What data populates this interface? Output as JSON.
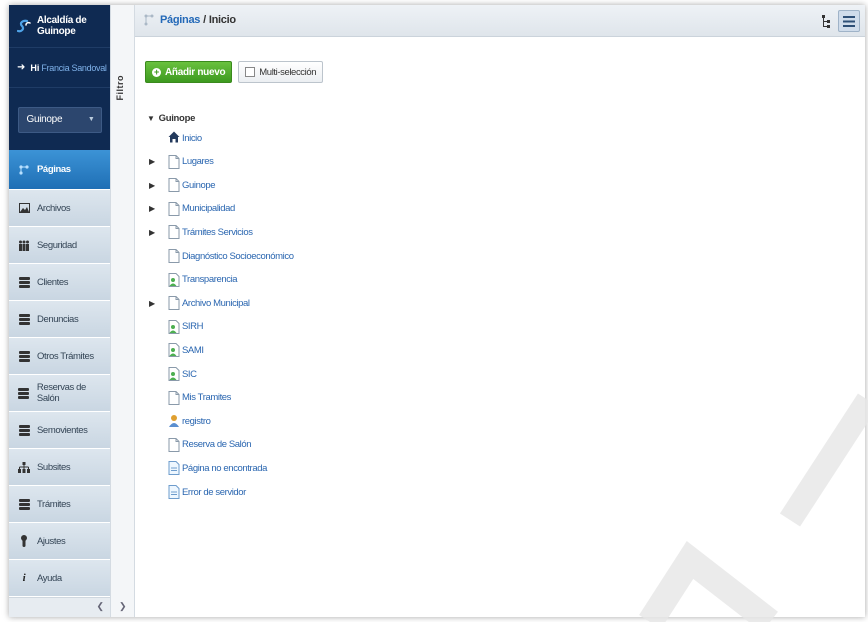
{
  "brand": {
    "line1": "Alcaldía de",
    "line2": "Guinope"
  },
  "user": {
    "greeting": "Hi",
    "name": "Francia Sandoval"
  },
  "site_select": {
    "value": "Guinope"
  },
  "sidebar": {
    "items": [
      {
        "label": "Páginas",
        "icon": "pages-icon",
        "active": true
      },
      {
        "label": "Archivos",
        "icon": "image-icon"
      },
      {
        "label": "Seguridad",
        "icon": "users-icon"
      },
      {
        "label": "Clientes",
        "icon": "database-icon"
      },
      {
        "label": "Denuncias",
        "icon": "database-icon"
      },
      {
        "label": "Otros Trámites",
        "icon": "database-icon"
      },
      {
        "label": "Reservas de Salón",
        "icon": "database-icon"
      },
      {
        "label": "Semovientes",
        "icon": "database-icon"
      },
      {
        "label": "Subsites",
        "icon": "sitemap-icon"
      },
      {
        "label": "Trámites",
        "icon": "database-icon"
      },
      {
        "label": "Ajustes",
        "icon": "wrench-icon"
      },
      {
        "label": "Ayuda",
        "icon": "info-icon"
      }
    ]
  },
  "filter_panel": {
    "label": "Filtro"
  },
  "breadcrumb": {
    "section": "Páginas",
    "separator": "/",
    "current": "Inicio"
  },
  "toolbar": {
    "add_label": "Añadir nuevo",
    "multi_label": "Multi-selección"
  },
  "tree": {
    "root": "Guinope",
    "nodes": [
      {
        "label": "Inicio",
        "icon": "home-icon",
        "expandable": false
      },
      {
        "label": "Lugares",
        "icon": "page-icon",
        "expandable": true
      },
      {
        "label": "Guinope",
        "icon": "page-icon",
        "expandable": true
      },
      {
        "label": "Municipalidad",
        "icon": "page-icon",
        "expandable": true
      },
      {
        "label": "Trámites Servicios",
        "icon": "page-icon",
        "expandable": true
      },
      {
        "label": "Diagnóstico Socioeconómico",
        "icon": "page-icon",
        "expandable": false
      },
      {
        "label": "Transparencia",
        "icon": "restricted-page-icon",
        "expandable": false
      },
      {
        "label": "Archivo Municipal",
        "icon": "page-icon",
        "expandable": true
      },
      {
        "label": "SIRH",
        "icon": "restricted-page-icon",
        "expandable": false
      },
      {
        "label": "SAMI",
        "icon": "restricted-page-icon",
        "expandable": false
      },
      {
        "label": "SIC",
        "icon": "restricted-page-icon",
        "expandable": false
      },
      {
        "label": "Mis Tramites",
        "icon": "page-icon",
        "expandable": false
      },
      {
        "label": "registro",
        "icon": "user-page-icon",
        "expandable": false
      },
      {
        "label": "Reserva de Salón",
        "icon": "page-icon",
        "expandable": false
      },
      {
        "label": "Página no encontrada",
        "icon": "error-page-icon",
        "expandable": false
      },
      {
        "label": "Error de servidor",
        "icon": "error-page-icon",
        "expandable": false
      }
    ]
  },
  "colors": {
    "brand_bg": "#0f2a52",
    "active_nav": "#1f6fb5",
    "link": "#2a66b0",
    "add_button": "#4aa72a"
  }
}
